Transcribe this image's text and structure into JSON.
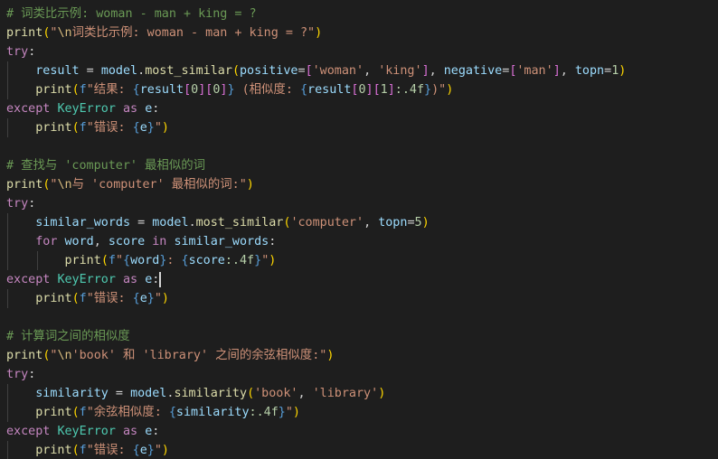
{
  "editor": {
    "lines": [
      {
        "guides": 0,
        "tokens": [
          {
            "t": "# 词类比示例: woman - man + king = ?",
            "c": "comment"
          }
        ]
      },
      {
        "guides": 0,
        "tokens": [
          {
            "t": "print",
            "c": "func"
          },
          {
            "t": "(",
            "c": "bracket1"
          },
          {
            "t": "\"",
            "c": "str"
          },
          {
            "t": "\\n",
            "c": "esc"
          },
          {
            "t": "词类比示例: woman - man + king = ?\"",
            "c": "str"
          },
          {
            "t": ")",
            "c": "bracket1"
          }
        ]
      },
      {
        "guides": 0,
        "tokens": [
          {
            "t": "try",
            "c": "ctrl"
          },
          {
            "t": ":",
            "c": "plain"
          }
        ]
      },
      {
        "guides": 1,
        "tokens": [
          {
            "t": "    ",
            "c": "plain"
          },
          {
            "t": "result",
            "c": "var"
          },
          {
            "t": " = ",
            "c": "op"
          },
          {
            "t": "model",
            "c": "var"
          },
          {
            "t": ".",
            "c": "plain"
          },
          {
            "t": "most_similar",
            "c": "func"
          },
          {
            "t": "(",
            "c": "bracket1"
          },
          {
            "t": "positive",
            "c": "var"
          },
          {
            "t": "=",
            "c": "op"
          },
          {
            "t": "[",
            "c": "bracket2"
          },
          {
            "t": "'woman'",
            "c": "str"
          },
          {
            "t": ", ",
            "c": "plain"
          },
          {
            "t": "'king'",
            "c": "str"
          },
          {
            "t": "]",
            "c": "bracket2"
          },
          {
            "t": ", ",
            "c": "plain"
          },
          {
            "t": "negative",
            "c": "var"
          },
          {
            "t": "=",
            "c": "op"
          },
          {
            "t": "[",
            "c": "bracket2"
          },
          {
            "t": "'man'",
            "c": "str"
          },
          {
            "t": "]",
            "c": "bracket2"
          },
          {
            "t": ", ",
            "c": "plain"
          },
          {
            "t": "topn",
            "c": "var"
          },
          {
            "t": "=",
            "c": "op"
          },
          {
            "t": "1",
            "c": "num"
          },
          {
            "t": ")",
            "c": "bracket1"
          }
        ]
      },
      {
        "guides": 1,
        "tokens": [
          {
            "t": "    ",
            "c": "plain"
          },
          {
            "t": "print",
            "c": "func"
          },
          {
            "t": "(",
            "c": "bracket1"
          },
          {
            "t": "f",
            "c": "kw"
          },
          {
            "t": "\"结果: ",
            "c": "str"
          },
          {
            "t": "{",
            "c": "kw"
          },
          {
            "t": "result",
            "c": "var"
          },
          {
            "t": "[",
            "c": "bracket2"
          },
          {
            "t": "0",
            "c": "num"
          },
          {
            "t": "]",
            "c": "bracket2"
          },
          {
            "t": "[",
            "c": "bracket2"
          },
          {
            "t": "0",
            "c": "num"
          },
          {
            "t": "]",
            "c": "bracket2"
          },
          {
            "t": "}",
            "c": "kw"
          },
          {
            "t": " (相似度: ",
            "c": "str"
          },
          {
            "t": "{",
            "c": "kw"
          },
          {
            "t": "result",
            "c": "var"
          },
          {
            "t": "[",
            "c": "bracket2"
          },
          {
            "t": "0",
            "c": "num"
          },
          {
            "t": "]",
            "c": "bracket2"
          },
          {
            "t": "[",
            "c": "bracket2"
          },
          {
            "t": "1",
            "c": "num"
          },
          {
            "t": "]",
            "c": "bracket2"
          },
          {
            "t": ":.4f",
            "c": "num"
          },
          {
            "t": "}",
            "c": "kw"
          },
          {
            "t": ")\"",
            "c": "str"
          },
          {
            "t": ")",
            "c": "bracket1"
          }
        ]
      },
      {
        "guides": 0,
        "tokens": [
          {
            "t": "except",
            "c": "ctrl"
          },
          {
            "t": " ",
            "c": "plain"
          },
          {
            "t": "KeyError",
            "c": "type"
          },
          {
            "t": " ",
            "c": "plain"
          },
          {
            "t": "as",
            "c": "ctrl"
          },
          {
            "t": " ",
            "c": "plain"
          },
          {
            "t": "e",
            "c": "var"
          },
          {
            "t": ":",
            "c": "plain"
          }
        ]
      },
      {
        "guides": 1,
        "tokens": [
          {
            "t": "    ",
            "c": "plain"
          },
          {
            "t": "print",
            "c": "func"
          },
          {
            "t": "(",
            "c": "bracket1"
          },
          {
            "t": "f",
            "c": "kw"
          },
          {
            "t": "\"错误: ",
            "c": "str"
          },
          {
            "t": "{",
            "c": "kw"
          },
          {
            "t": "e",
            "c": "var"
          },
          {
            "t": "}",
            "c": "kw"
          },
          {
            "t": "\"",
            "c": "str"
          },
          {
            "t": ")",
            "c": "bracket1"
          }
        ]
      },
      {
        "guides": 0,
        "tokens": []
      },
      {
        "guides": 0,
        "tokens": [
          {
            "t": "# 查找与 'computer' 最相似的词",
            "c": "comment"
          }
        ]
      },
      {
        "guides": 0,
        "tokens": [
          {
            "t": "print",
            "c": "func"
          },
          {
            "t": "(",
            "c": "bracket1"
          },
          {
            "t": "\"",
            "c": "str"
          },
          {
            "t": "\\n",
            "c": "esc"
          },
          {
            "t": "与 'computer' 最相似的词:\"",
            "c": "str"
          },
          {
            "t": ")",
            "c": "bracket1"
          }
        ]
      },
      {
        "guides": 0,
        "tokens": [
          {
            "t": "try",
            "c": "ctrl"
          },
          {
            "t": ":",
            "c": "plain"
          }
        ]
      },
      {
        "guides": 1,
        "tokens": [
          {
            "t": "    ",
            "c": "plain"
          },
          {
            "t": "similar_words",
            "c": "var"
          },
          {
            "t": " = ",
            "c": "op"
          },
          {
            "t": "model",
            "c": "var"
          },
          {
            "t": ".",
            "c": "plain"
          },
          {
            "t": "most_similar",
            "c": "func"
          },
          {
            "t": "(",
            "c": "bracket1"
          },
          {
            "t": "'computer'",
            "c": "str"
          },
          {
            "t": ", ",
            "c": "plain"
          },
          {
            "t": "topn",
            "c": "var"
          },
          {
            "t": "=",
            "c": "op"
          },
          {
            "t": "5",
            "c": "num"
          },
          {
            "t": ")",
            "c": "bracket1"
          }
        ]
      },
      {
        "guides": 1,
        "tokens": [
          {
            "t": "    ",
            "c": "plain"
          },
          {
            "t": "for",
            "c": "ctrl"
          },
          {
            "t": " ",
            "c": "plain"
          },
          {
            "t": "word",
            "c": "var"
          },
          {
            "t": ", ",
            "c": "plain"
          },
          {
            "t": "score",
            "c": "var"
          },
          {
            "t": " ",
            "c": "plain"
          },
          {
            "t": "in",
            "c": "ctrl"
          },
          {
            "t": " ",
            "c": "plain"
          },
          {
            "t": "similar_words",
            "c": "var"
          },
          {
            "t": ":",
            "c": "plain"
          }
        ]
      },
      {
        "guides": 2,
        "tokens": [
          {
            "t": "        ",
            "c": "plain"
          },
          {
            "t": "print",
            "c": "func"
          },
          {
            "t": "(",
            "c": "bracket1"
          },
          {
            "t": "f",
            "c": "kw"
          },
          {
            "t": "\"",
            "c": "str"
          },
          {
            "t": "{",
            "c": "kw"
          },
          {
            "t": "word",
            "c": "var"
          },
          {
            "t": "}",
            "c": "kw"
          },
          {
            "t": ": ",
            "c": "str"
          },
          {
            "t": "{",
            "c": "kw"
          },
          {
            "t": "score",
            "c": "var"
          },
          {
            "t": ":.4f",
            "c": "num"
          },
          {
            "t": "}",
            "c": "kw"
          },
          {
            "t": "\"",
            "c": "str"
          },
          {
            "t": ")",
            "c": "bracket1"
          }
        ]
      },
      {
        "guides": 0,
        "cursor": true,
        "tokens": [
          {
            "t": "except",
            "c": "ctrl"
          },
          {
            "t": " ",
            "c": "plain"
          },
          {
            "t": "KeyError",
            "c": "type"
          },
          {
            "t": " ",
            "c": "plain"
          },
          {
            "t": "as",
            "c": "ctrl"
          },
          {
            "t": " ",
            "c": "plain"
          },
          {
            "t": "e",
            "c": "var"
          },
          {
            "t": ":",
            "c": "plain"
          }
        ]
      },
      {
        "guides": 1,
        "tokens": [
          {
            "t": "    ",
            "c": "plain"
          },
          {
            "t": "print",
            "c": "func"
          },
          {
            "t": "(",
            "c": "bracket1"
          },
          {
            "t": "f",
            "c": "kw"
          },
          {
            "t": "\"错误: ",
            "c": "str"
          },
          {
            "t": "{",
            "c": "kw"
          },
          {
            "t": "e",
            "c": "var"
          },
          {
            "t": "}",
            "c": "kw"
          },
          {
            "t": "\"",
            "c": "str"
          },
          {
            "t": ")",
            "c": "bracket1"
          }
        ]
      },
      {
        "guides": 0,
        "tokens": []
      },
      {
        "guides": 0,
        "tokens": [
          {
            "t": "# 计算词之间的相似度",
            "c": "comment"
          }
        ]
      },
      {
        "guides": 0,
        "tokens": [
          {
            "t": "print",
            "c": "func"
          },
          {
            "t": "(",
            "c": "bracket1"
          },
          {
            "t": "\"",
            "c": "str"
          },
          {
            "t": "\\n",
            "c": "esc"
          },
          {
            "t": "'book' 和 'library' 之间的余弦相似度:\"",
            "c": "str"
          },
          {
            "t": ")",
            "c": "bracket1"
          }
        ]
      },
      {
        "guides": 0,
        "tokens": [
          {
            "t": "try",
            "c": "ctrl"
          },
          {
            "t": ":",
            "c": "plain"
          }
        ]
      },
      {
        "guides": 1,
        "tokens": [
          {
            "t": "    ",
            "c": "plain"
          },
          {
            "t": "similarity",
            "c": "var"
          },
          {
            "t": " = ",
            "c": "op"
          },
          {
            "t": "model",
            "c": "var"
          },
          {
            "t": ".",
            "c": "plain"
          },
          {
            "t": "similarity",
            "c": "func"
          },
          {
            "t": "(",
            "c": "bracket1"
          },
          {
            "t": "'book'",
            "c": "str"
          },
          {
            "t": ", ",
            "c": "plain"
          },
          {
            "t": "'library'",
            "c": "str"
          },
          {
            "t": ")",
            "c": "bracket1"
          }
        ]
      },
      {
        "guides": 1,
        "tokens": [
          {
            "t": "    ",
            "c": "plain"
          },
          {
            "t": "print",
            "c": "func"
          },
          {
            "t": "(",
            "c": "bracket1"
          },
          {
            "t": "f",
            "c": "kw"
          },
          {
            "t": "\"余弦相似度: ",
            "c": "str"
          },
          {
            "t": "{",
            "c": "kw"
          },
          {
            "t": "similarity",
            "c": "var"
          },
          {
            "t": ":.4f",
            "c": "num"
          },
          {
            "t": "}",
            "c": "kw"
          },
          {
            "t": "\"",
            "c": "str"
          },
          {
            "t": ")",
            "c": "bracket1"
          }
        ]
      },
      {
        "guides": 0,
        "tokens": [
          {
            "t": "except",
            "c": "ctrl"
          },
          {
            "t": " ",
            "c": "plain"
          },
          {
            "t": "KeyError",
            "c": "type"
          },
          {
            "t": " ",
            "c": "plain"
          },
          {
            "t": "as",
            "c": "ctrl"
          },
          {
            "t": " ",
            "c": "plain"
          },
          {
            "t": "e",
            "c": "var"
          },
          {
            "t": ":",
            "c": "plain"
          }
        ]
      },
      {
        "guides": 1,
        "tokens": [
          {
            "t": "    ",
            "c": "plain"
          },
          {
            "t": "print",
            "c": "func"
          },
          {
            "t": "(",
            "c": "bracket1"
          },
          {
            "t": "f",
            "c": "kw"
          },
          {
            "t": "\"错误: ",
            "c": "str"
          },
          {
            "t": "{",
            "c": "kw"
          },
          {
            "t": "e",
            "c": "var"
          },
          {
            "t": "}",
            "c": "kw"
          },
          {
            "t": "\"",
            "c": "str"
          },
          {
            "t": ")",
            "c": "bracket1"
          }
        ]
      }
    ]
  }
}
